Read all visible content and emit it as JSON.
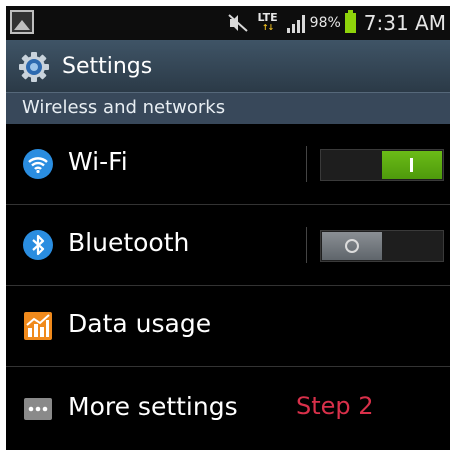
{
  "status_bar": {
    "battery_percent": "98%",
    "time": "7:31 AM",
    "network_label": "LTE",
    "icons": [
      "gallery-icon",
      "mute-icon",
      "lte-icon",
      "signal-icon",
      "battery-icon"
    ]
  },
  "title_bar": {
    "title": "Settings",
    "icon": "gear-icon"
  },
  "section": {
    "header": "Wireless and networks"
  },
  "rows": [
    {
      "label": "Wi-Fi",
      "icon": "wifi-icon",
      "toggle": "on"
    },
    {
      "label": "Bluetooth",
      "icon": "bluetooth-icon",
      "toggle": "off"
    },
    {
      "label": "Data usage",
      "icon": "data-usage-icon"
    },
    {
      "label": "More settings",
      "icon": "more-settings-icon"
    }
  ],
  "annotation": {
    "text": "Step 2"
  },
  "colors": {
    "toggle_on": "#5aa512",
    "title_bar": "#34495b",
    "section_header": "#38485a",
    "annotation": "#d9304a",
    "wifi_icon": "#2a8de0",
    "data_usage_icon": "#f08a1c"
  }
}
